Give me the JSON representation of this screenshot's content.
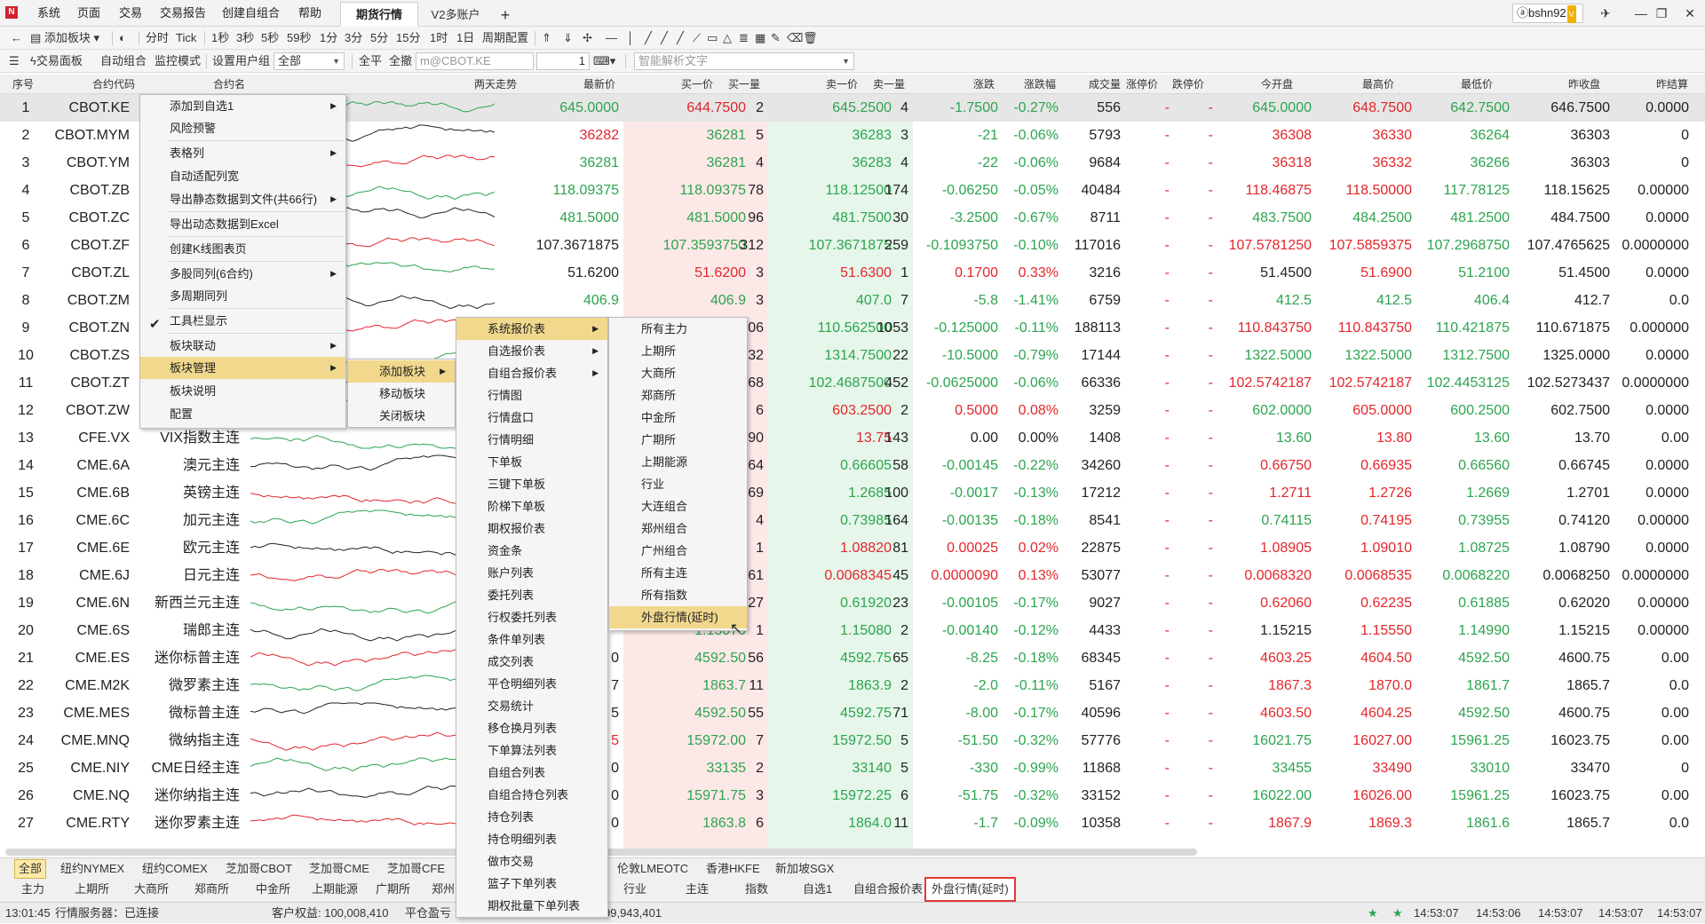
{
  "window": {
    "menu": [
      "系统",
      "页面",
      "交易",
      "交易报告",
      "创建自组合",
      "帮助"
    ],
    "tabs": [
      "期货行情",
      "V2多账户"
    ],
    "add_tab": "+",
    "user": "bshn92",
    "vip": "V"
  },
  "toolbar1": {
    "add_board": "添加板块",
    "periods": [
      "分时",
      "Tick",
      "1秒",
      "3秒",
      "5秒",
      "59秒",
      "1分",
      "3分",
      "5分",
      "15分",
      "1时",
      "1日",
      "周期配置"
    ]
  },
  "toolbar2": {
    "trade_panel": "交易面板",
    "auto_combo": "自动组合",
    "monitor_mode": "监控模式",
    "user_group_label": "设置用户组",
    "user_group_value": "全部",
    "close_all": "全平",
    "cancel_all": "全撤",
    "order_input_placeholder": "m@CBOT.KE",
    "qty": "1",
    "smart_parse_placeholder": "智能解析文字"
  },
  "columns": [
    "序号",
    "合约代码",
    "合约名",
    "两天走势",
    "最新价",
    "买一价",
    "买一量",
    "卖一价",
    "卖一量",
    "涨跌",
    "涨跌幅",
    "成交量",
    "涨停价",
    "跌停价",
    "今开盘",
    "最高价",
    "最低价",
    "昨收盘",
    "昨结算"
  ],
  "rows": [
    {
      "n": "1",
      "code": "CBOT.KE",
      "name": "",
      "last": "645.0000",
      "bid": "644.7500",
      "bq": "2",
      "ask": "645.2500",
      "aq": "4",
      "chg": "-1.7500",
      "pct": "-0.27%",
      "vol": "556",
      "lu": "-",
      "ld": "-",
      "open": "645.0000",
      "high": "648.7500",
      "low": "642.7500",
      "pc": "646.7500",
      "ps": "0.0000",
      "c": [
        "dn",
        "up",
        "nt",
        "dn",
        "nt",
        "dn",
        "dn",
        "nt",
        "dn",
        "up",
        "dn"
      ]
    },
    {
      "n": "2",
      "code": "CBOT.MYM",
      "name": "",
      "last": "36282",
      "bid": "36281",
      "bq": "5",
      "ask": "36283",
      "aq": "3",
      "chg": "-21",
      "pct": "-0.06%",
      "vol": "5793",
      "lu": "-",
      "ld": "-",
      "open": "36308",
      "high": "36330",
      "low": "36264",
      "pc": "36303",
      "ps": "0",
      "c": [
        "up",
        "dn",
        "nt",
        "dn",
        "nt",
        "dn",
        "dn",
        "nt",
        "up",
        "up",
        "dn"
      ]
    },
    {
      "n": "3",
      "code": "CBOT.YM",
      "name": "",
      "last": "36281",
      "bid": "36281",
      "bq": "4",
      "ask": "36283",
      "aq": "4",
      "chg": "-22",
      "pct": "-0.06%",
      "vol": "9684",
      "lu": "-",
      "ld": "-",
      "open": "36318",
      "high": "36332",
      "low": "36266",
      "pc": "36303",
      "ps": "0",
      "c": [
        "dn",
        "dn",
        "nt",
        "dn",
        "nt",
        "dn",
        "dn",
        "nt",
        "up",
        "up",
        "dn"
      ]
    },
    {
      "n": "4",
      "code": "CBOT.ZB",
      "name": "",
      "last": "118.09375",
      "bid": "118.09375",
      "bq": "78",
      "ask": "118.12500",
      "aq": "174",
      "chg": "-0.06250",
      "pct": "-0.05%",
      "vol": "40484",
      "lu": "-",
      "ld": "-",
      "open": "118.46875",
      "high": "118.50000",
      "low": "117.78125",
      "pc": "118.15625",
      "ps": "0.00000",
      "c": [
        "dn",
        "dn",
        "nt",
        "dn",
        "nt",
        "dn",
        "dn",
        "nt",
        "up",
        "up",
        "dn"
      ]
    },
    {
      "n": "5",
      "code": "CBOT.ZC",
      "name": "",
      "last": "481.5000",
      "bid": "481.5000",
      "bq": "96",
      "ask": "481.7500",
      "aq": "30",
      "chg": "-3.2500",
      "pct": "-0.67%",
      "vol": "8711",
      "lu": "-",
      "ld": "-",
      "open": "483.7500",
      "high": "484.2500",
      "low": "481.2500",
      "pc": "484.7500",
      "ps": "0.0000",
      "c": [
        "dn",
        "dn",
        "nt",
        "dn",
        "nt",
        "dn",
        "dn",
        "nt",
        "dn",
        "dn",
        "dn"
      ]
    },
    {
      "n": "6",
      "code": "CBOT.ZF",
      "name": "",
      "last": "107.3671875",
      "bid": "107.3593750",
      "bq": "312",
      "ask": "107.3671875",
      "aq": "259",
      "chg": "-0.1093750",
      "pct": "-0.10%",
      "vol": "117016",
      "lu": "-",
      "ld": "-",
      "open": "107.5781250",
      "high": "107.5859375",
      "low": "107.2968750",
      "pc": "107.4765625",
      "ps": "0.0000000",
      "c": [
        "nt",
        "dn",
        "nt",
        "dn",
        "nt",
        "dn",
        "dn",
        "nt",
        "up",
        "up",
        "dn"
      ]
    },
    {
      "n": "7",
      "code": "CBOT.ZL",
      "name": "",
      "last": "51.6200",
      "bid": "51.6200",
      "bq": "3",
      "ask": "51.6300",
      "aq": "1",
      "chg": "0.1700",
      "pct": "0.33%",
      "vol": "3216",
      "lu": "-",
      "ld": "-",
      "open": "51.4500",
      "high": "51.6900",
      "low": "51.2100",
      "pc": "51.4500",
      "ps": "0.0000",
      "c": [
        "nt",
        "up",
        "nt",
        "up",
        "nt",
        "up",
        "up",
        "nt",
        "nt",
        "up",
        "dn"
      ]
    },
    {
      "n": "8",
      "code": "CBOT.ZM",
      "name": "",
      "last": "406.9",
      "bid": "406.9",
      "bq": "3",
      "ask": "407.0",
      "aq": "7",
      "chg": "-5.8",
      "pct": "-1.41%",
      "vol": "6759",
      "lu": "-",
      "ld": "-",
      "open": "412.5",
      "high": "412.5",
      "low": "406.4",
      "pc": "412.7",
      "ps": "0.0",
      "c": [
        "dn",
        "dn",
        "nt",
        "dn",
        "nt",
        "dn",
        "dn",
        "nt",
        "dn",
        "dn",
        "dn"
      ]
    },
    {
      "n": "9",
      "code": "CBOT.ZN",
      "name": "",
      "last": "",
      "bid": "",
      "bq": "06",
      "ask": "110.562500",
      "aq": "1053",
      "chg": "-0.125000",
      "pct": "-0.11%",
      "vol": "188113",
      "lu": "-",
      "ld": "-",
      "open": "110.843750",
      "high": "110.843750",
      "low": "110.421875",
      "pc": "110.671875",
      "ps": "0.000000",
      "c": [
        "nt",
        "nt",
        "nt",
        "dn",
        "nt",
        "dn",
        "dn",
        "nt",
        "up",
        "up",
        "dn"
      ]
    },
    {
      "n": "10",
      "code": "CBOT.ZS",
      "name": "",
      "last": "",
      "bid": "",
      "bq": "32",
      "ask": "1314.7500",
      "aq": "22",
      "chg": "-10.5000",
      "pct": "-0.79%",
      "vol": "17144",
      "lu": "-",
      "ld": "-",
      "open": "1322.5000",
      "high": "1322.5000",
      "low": "1312.7500",
      "pc": "1325.0000",
      "ps": "0.0000",
      "c": [
        "nt",
        "nt",
        "nt",
        "dn",
        "nt",
        "dn",
        "dn",
        "nt",
        "dn",
        "dn",
        "dn"
      ]
    },
    {
      "n": "11",
      "code": "CBOT.ZT",
      "name": "",
      "last": "",
      "bid": "",
      "bq": "68",
      "ask": "102.4687500",
      "aq": "452",
      "chg": "-0.0625000",
      "pct": "-0.06%",
      "vol": "66336",
      "lu": "-",
      "ld": "-",
      "open": "102.5742187",
      "high": "102.5742187",
      "low": "102.4453125",
      "pc": "102.5273437",
      "ps": "0.0000000",
      "c": [
        "nt",
        "nt",
        "nt",
        "dn",
        "nt",
        "dn",
        "dn",
        "nt",
        "up",
        "up",
        "dn"
      ]
    },
    {
      "n": "12",
      "code": "CBOT.ZW",
      "name": "",
      "last": "",
      "bid": "",
      "bq": "6",
      "ask": "603.2500",
      "aq": "2",
      "chg": "0.5000",
      "pct": "0.08%",
      "vol": "3259",
      "lu": "-",
      "ld": "-",
      "open": "602.0000",
      "high": "605.0000",
      "low": "600.2500",
      "pc": "602.7500",
      "ps": "0.0000",
      "c": [
        "nt",
        "nt",
        "nt",
        "up",
        "nt",
        "up",
        "up",
        "nt",
        "dn",
        "up",
        "dn"
      ]
    },
    {
      "n": "13",
      "code": "CFE.VX",
      "name": "VIX指数主连",
      "last": "",
      "bid": "",
      "bq": "90",
      "ask": "13.75",
      "aq": "143",
      "chg": "0.00",
      "pct": "0.00%",
      "vol": "1408",
      "lu": "-",
      "ld": "-",
      "open": "13.60",
      "high": "13.80",
      "low": "13.60",
      "pc": "13.70",
      "ps": "0.00",
      "c": [
        "nt",
        "nt",
        "nt",
        "up",
        "nt",
        "nt",
        "nt",
        "nt",
        "dn",
        "up",
        "dn"
      ]
    },
    {
      "n": "14",
      "code": "CME.6A",
      "name": "澳元主连",
      "last": "",
      "bid": "",
      "bq": "64",
      "ask": "0.66605",
      "aq": "58",
      "chg": "-0.00145",
      "pct": "-0.22%",
      "vol": "34260",
      "lu": "-",
      "ld": "-",
      "open": "0.66750",
      "high": "0.66935",
      "low": "0.66560",
      "pc": "0.66745",
      "ps": "0.0000",
      "c": [
        "nt",
        "nt",
        "nt",
        "dn",
        "nt",
        "dn",
        "dn",
        "nt",
        "up",
        "up",
        "dn"
      ]
    },
    {
      "n": "15",
      "code": "CME.6B",
      "name": "英镑主连",
      "last": "",
      "bid": "",
      "bq": "69",
      "ask": "1.2685",
      "aq": "100",
      "chg": "-0.0017",
      "pct": "-0.13%",
      "vol": "17212",
      "lu": "-",
      "ld": "-",
      "open": "1.2711",
      "high": "1.2726",
      "low": "1.2669",
      "pc": "1.2701",
      "ps": "0.0000",
      "c": [
        "nt",
        "nt",
        "nt",
        "dn",
        "nt",
        "dn",
        "dn",
        "nt",
        "up",
        "up",
        "dn"
      ]
    },
    {
      "n": "16",
      "code": "CME.6C",
      "name": "加元主连",
      "last": "",
      "bid": "",
      "bq": "4",
      "ask": "0.73985",
      "aq": "164",
      "chg": "-0.00135",
      "pct": "-0.18%",
      "vol": "8541",
      "lu": "-",
      "ld": "-",
      "open": "0.74115",
      "high": "0.74195",
      "low": "0.73955",
      "pc": "0.74120",
      "ps": "0.00000",
      "c": [
        "nt",
        "nt",
        "nt",
        "dn",
        "nt",
        "dn",
        "dn",
        "nt",
        "dn",
        "up",
        "dn"
      ]
    },
    {
      "n": "17",
      "code": "CME.6E",
      "name": "欧元主连",
      "last": "",
      "bid": "",
      "bq": "1",
      "ask": "1.08820",
      "aq": "81",
      "chg": "0.00025",
      "pct": "0.02%",
      "vol": "22875",
      "lu": "-",
      "ld": "-",
      "open": "1.08905",
      "high": "1.09010",
      "low": "1.08725",
      "pc": "1.08790",
      "ps": "0.0000",
      "c": [
        "nt",
        "nt",
        "nt",
        "up",
        "nt",
        "up",
        "up",
        "nt",
        "up",
        "up",
        "dn"
      ]
    },
    {
      "n": "18",
      "code": "CME.6J",
      "name": "日元主连",
      "last": "",
      "bid": "",
      "bq": "61",
      "ask": "0.0068345",
      "aq": "45",
      "chg": "0.0000090",
      "pct": "0.13%",
      "vol": "53077",
      "lu": "-",
      "ld": "-",
      "open": "0.0068320",
      "high": "0.0068535",
      "low": "0.0068220",
      "pc": "0.0068250",
      "ps": "0.0000000",
      "c": [
        "nt",
        "nt",
        "nt",
        "up",
        "nt",
        "up",
        "up",
        "nt",
        "up",
        "up",
        "dn"
      ]
    },
    {
      "n": "19",
      "code": "CME.6N",
      "name": "新西兰元主连",
      "last": "",
      "bid": "",
      "bq": "27",
      "ask": "0.61920",
      "aq": "23",
      "chg": "-0.00105",
      "pct": "-0.17%",
      "vol": "9027",
      "lu": "-",
      "ld": "-",
      "open": "0.62060",
      "high": "0.62235",
      "low": "0.61885",
      "pc": "0.62020",
      "ps": "0.00000",
      "c": [
        "nt",
        "nt",
        "nt",
        "dn",
        "nt",
        "dn",
        "dn",
        "nt",
        "up",
        "up",
        "dn"
      ]
    },
    {
      "n": "20",
      "code": "CME.6S",
      "name": "瑞郎主连",
      "last": "",
      "bid": "1.15070",
      "bq": "1",
      "ask": "1.15080",
      "aq": "2",
      "chg": "-0.00140",
      "pct": "-0.12%",
      "vol": "4433",
      "lu": "-",
      "ld": "-",
      "open": "1.15215",
      "high": "1.15550",
      "low": "1.14990",
      "pc": "1.15215",
      "ps": "0.00000",
      "c": [
        "nt",
        "dn",
        "nt",
        "dn",
        "nt",
        "dn",
        "dn",
        "nt",
        "nt",
        "up",
        "dn"
      ]
    },
    {
      "n": "21",
      "code": "CME.ES",
      "name": "迷你标普主连",
      "last": "0",
      "bid": "4592.50",
      "bq": "56",
      "ask": "4592.75",
      "aq": "65",
      "chg": "-8.25",
      "pct": "-0.18%",
      "vol": "68345",
      "lu": "-",
      "ld": "-",
      "open": "4603.25",
      "high": "4604.50",
      "low": "4592.50",
      "pc": "4600.75",
      "ps": "0.00",
      "c": [
        "nt",
        "dn",
        "nt",
        "dn",
        "nt",
        "dn",
        "dn",
        "nt",
        "up",
        "up",
        "dn"
      ]
    },
    {
      "n": "22",
      "code": "CME.M2K",
      "name": "微罗素主连",
      "last": "7",
      "bid": "1863.7",
      "bq": "11",
      "ask": "1863.9",
      "aq": "2",
      "chg": "-2.0",
      "pct": "-0.11%",
      "vol": "5167",
      "lu": "-",
      "ld": "-",
      "open": "1867.3",
      "high": "1870.0",
      "low": "1861.7",
      "pc": "1865.7",
      "ps": "0.0",
      "c": [
        "nt",
        "dn",
        "nt",
        "dn",
        "nt",
        "dn",
        "dn",
        "nt",
        "up",
        "up",
        "dn"
      ]
    },
    {
      "n": "23",
      "code": "CME.MES",
      "name": "微标普主连",
      "last": "5",
      "bid": "4592.50",
      "bq": "55",
      "ask": "4592.75",
      "aq": "71",
      "chg": "-8.00",
      "pct": "-0.17%",
      "vol": "40596",
      "lu": "-",
      "ld": "-",
      "open": "4603.50",
      "high": "4604.25",
      "low": "4592.50",
      "pc": "4600.75",
      "ps": "0.00",
      "c": [
        "nt",
        "dn",
        "nt",
        "dn",
        "nt",
        "dn",
        "dn",
        "nt",
        "up",
        "up",
        "dn"
      ]
    },
    {
      "n": "24",
      "code": "CME.MNQ",
      "name": "微纳指主连",
      "last": "5",
      "bid": "15972.00",
      "bq": "7",
      "ask": "15972.50",
      "aq": "5",
      "chg": "-51.50",
      "pct": "-0.32%",
      "vol": "57776",
      "lu": "-",
      "ld": "-",
      "open": "16021.75",
      "high": "16027.00",
      "low": "15961.25",
      "pc": "16023.75",
      "ps": "0.00",
      "c": [
        "up",
        "dn",
        "nt",
        "dn",
        "nt",
        "dn",
        "dn",
        "nt",
        "dn",
        "up",
        "dn"
      ]
    },
    {
      "n": "25",
      "code": "CME.NIY",
      "name": "CME日经主连",
      "last": "0",
      "bid": "33135",
      "bq": "2",
      "ask": "33140",
      "aq": "5",
      "chg": "-330",
      "pct": "-0.99%",
      "vol": "11868",
      "lu": "-",
      "ld": "-",
      "open": "33455",
      "high": "33490",
      "low": "33010",
      "pc": "33470",
      "ps": "0",
      "c": [
        "nt",
        "dn",
        "nt",
        "dn",
        "nt",
        "dn",
        "dn",
        "nt",
        "dn",
        "up",
        "dn"
      ]
    },
    {
      "n": "26",
      "code": "CME.NQ",
      "name": "迷你纳指主连",
      "last": "0",
      "bid": "15971.75",
      "bq": "3",
      "ask": "15972.25",
      "aq": "6",
      "chg": "-51.75",
      "pct": "-0.32%",
      "vol": "33152",
      "lu": "-",
      "ld": "-",
      "open": "16022.00",
      "high": "16026.00",
      "low": "15961.25",
      "pc": "16023.75",
      "ps": "0.00",
      "c": [
        "nt",
        "dn",
        "nt",
        "dn",
        "nt",
        "dn",
        "dn",
        "nt",
        "dn",
        "up",
        "dn"
      ]
    },
    {
      "n": "27",
      "code": "CME.RTY",
      "name": "迷你罗素主连",
      "last": "0",
      "bid": "1863.8",
      "bq": "6",
      "ask": "1864.0",
      "aq": "11",
      "chg": "-1.7",
      "pct": "-0.09%",
      "vol": "10358",
      "lu": "-",
      "ld": "-",
      "open": "1867.9",
      "high": "1869.3",
      "low": "1861.6",
      "pc": "1865.7",
      "ps": "0.0",
      "c": [
        "nt",
        "dn",
        "nt",
        "dn",
        "nt",
        "dn",
        "dn",
        "nt",
        "up",
        "up",
        "dn"
      ]
    }
  ],
  "context_menu": {
    "items": [
      "添加到自选1",
      "风险预警",
      "表格列",
      "自动适配列宽",
      "导出静态数据到文件(共66行)",
      "导出动态数据到Excel",
      "创建K线图表页",
      "多股同列(6合约)",
      "多周期同列",
      "工具栏显示",
      "板块联动",
      "板块管理",
      "板块说明",
      "配置"
    ]
  },
  "board_menu": {
    "items": [
      "添加板块",
      "移动板块",
      "关闭板块"
    ]
  },
  "add_board_menu": {
    "items": [
      "系统报价表",
      "自选报价表",
      "自组合报价表",
      "行情图",
      "行情盘口",
      "行情明细",
      "下单板",
      "三键下单板",
      "阶梯下单板",
      "期权报价表",
      "资金条",
      "账户列表",
      "委托列表",
      "行权委托列表",
      "条件单列表",
      "成交列表",
      "平仓明细列表",
      "交易统计",
      "移仓换月列表",
      "下单算法列表",
      "自组合列表",
      "自组合持仓列表",
      "持仓列表",
      "持仓明细列表",
      "做市交易",
      "篮子下单列表",
      "期权批量下单列表"
    ]
  },
  "system_quote_menu": {
    "items": [
      "所有主力",
      "上期所",
      "大商所",
      "郑商所",
      "中金所",
      "广期所",
      "上期能源",
      "行业",
      "大连组合",
      "郑州组合",
      "广州组合",
      "所有主连",
      "所有指数",
      "外盘行情(延时)"
    ]
  },
  "bottom_tabs1": [
    "全部",
    "纽约NYMEX",
    "纽约COMEX",
    "芝加哥CBOT",
    "芝加哥CME",
    "芝加哥CFE",
    "伦敦LMEOTC",
    "香港HKFE",
    "新加坡SGX"
  ],
  "bottom_tabs2": [
    "主力",
    "上期所",
    "大商所",
    "郑商所",
    "中金所",
    "上期能源",
    "广期所",
    "郑州",
    "行业",
    "主连",
    "指数",
    "自选1",
    "自组合报价表",
    "外盘行情(延时)"
  ],
  "status": {
    "time": "13:01:45",
    "server_label": "行情服务器：已连接",
    "equity": "客户权益: 100,008,410",
    "pnl": "平仓盈亏",
    "avail": "99,943,401",
    "clocks": [
      "14:53:07",
      "14:53:06",
      "14:53:07",
      "14:53:07",
      "14:53:07"
    ]
  },
  "colors": {
    "up": "#e2262b",
    "down": "#2ca44e",
    "highlight": "#f1d88d",
    "bid_bg": "#fde8e8",
    "ask_bg": "#e6f6ea"
  }
}
